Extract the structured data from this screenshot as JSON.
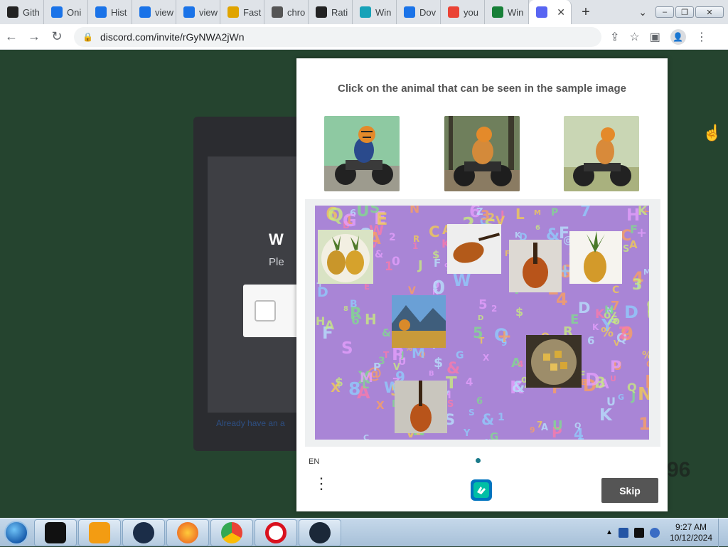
{
  "browser": {
    "tabs": [
      {
        "label": "Gith",
        "icon": "github-icon",
        "color": "#222222"
      },
      {
        "label": "Oni",
        "icon": "appstore-icon",
        "color": "#1a73e8"
      },
      {
        "label": "Hist",
        "icon": "history-icon",
        "color": "#1a73e8"
      },
      {
        "label": "view",
        "icon": "history-icon",
        "color": "#1a73e8"
      },
      {
        "label": "view",
        "icon": "history-icon",
        "color": "#1a73e8"
      },
      {
        "label": "Fast",
        "icon": "stack-icon",
        "color": "#e0a400"
      },
      {
        "label": "chro",
        "icon": "chrome-icon",
        "color": "#555555"
      },
      {
        "label": "Rati",
        "icon": "github-icon",
        "color": "#222222"
      },
      {
        "label": "Win",
        "icon": "teal-app-icon",
        "color": "#17a2b8"
      },
      {
        "label": "Dov",
        "icon": "download-icon",
        "color": "#1a73e8"
      },
      {
        "label": "you",
        "icon": "google-icon",
        "color": "#ea4335"
      },
      {
        "label": "Win",
        "icon": "sheet-icon",
        "color": "#188038"
      },
      {
        "label": "",
        "icon": "discord-icon",
        "color": "#5865f2",
        "active": true
      }
    ],
    "new_tab": "+",
    "url": "discord.com/invite/rGyNWA2jWn"
  },
  "discord": {
    "title": "W",
    "subtitle": "Ple",
    "link": "Already have an a",
    "bg_number": "96"
  },
  "captcha": {
    "prompt": "Click on the animal that can be seen in the sample image",
    "language": "EN",
    "skip_label": "Skip",
    "menu_glyph": "⋮",
    "samples": [
      "tiger on motorcycle",
      "tiger on motorcycle",
      "tiger on motorcycle"
    ],
    "tiles": [
      "pineapples",
      "violin",
      "violin",
      "pineapple",
      "tiger in landscape",
      "bowl of food",
      "violin"
    ]
  },
  "taskbar": {
    "apps": [
      "folder-icon",
      "media-player-icon",
      "globe-icon",
      "firefox-icon",
      "chrome-icon",
      "opera-icon",
      "steam-icon"
    ],
    "time": "9:27 AM",
    "date": "10/12/2024"
  }
}
